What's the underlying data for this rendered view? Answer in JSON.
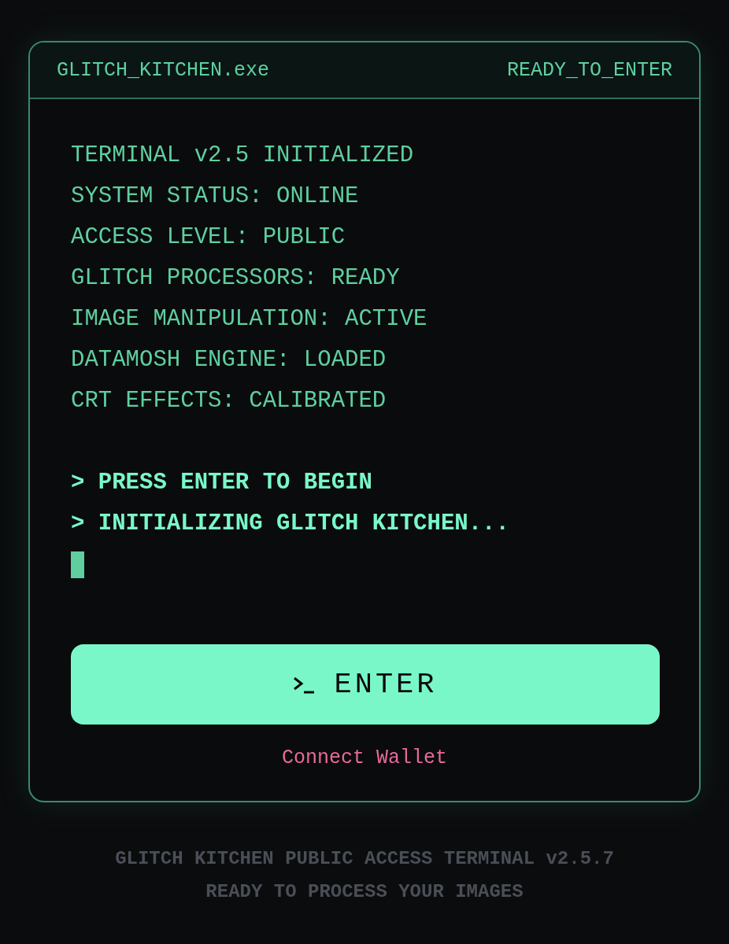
{
  "window": {
    "title": "GLITCH_KITCHEN.exe",
    "status": "READY_TO_ENTER"
  },
  "status_lines": [
    "TERMINAL v2.5 INITIALIZED",
    "SYSTEM STATUS: ONLINE",
    "ACCESS LEVEL: PUBLIC",
    "GLITCH PROCESSORS: READY",
    "IMAGE MANIPULATION: ACTIVE",
    "DATAMOSH ENGINE: LOADED",
    "CRT EFFECTS: CALIBRATED"
  ],
  "prompt_lines": [
    "> PRESS ENTER TO BEGIN",
    "> INITIALIZING GLITCH KITCHEN..."
  ],
  "enter_button": {
    "label": "ENTER"
  },
  "wallet_link": {
    "label": "Connect Wallet"
  },
  "footer": [
    "GLITCH KITCHEN PUBLIC ACCESS TERMINAL v2.5.7",
    "READY TO PROCESS YOUR IMAGES"
  ]
}
